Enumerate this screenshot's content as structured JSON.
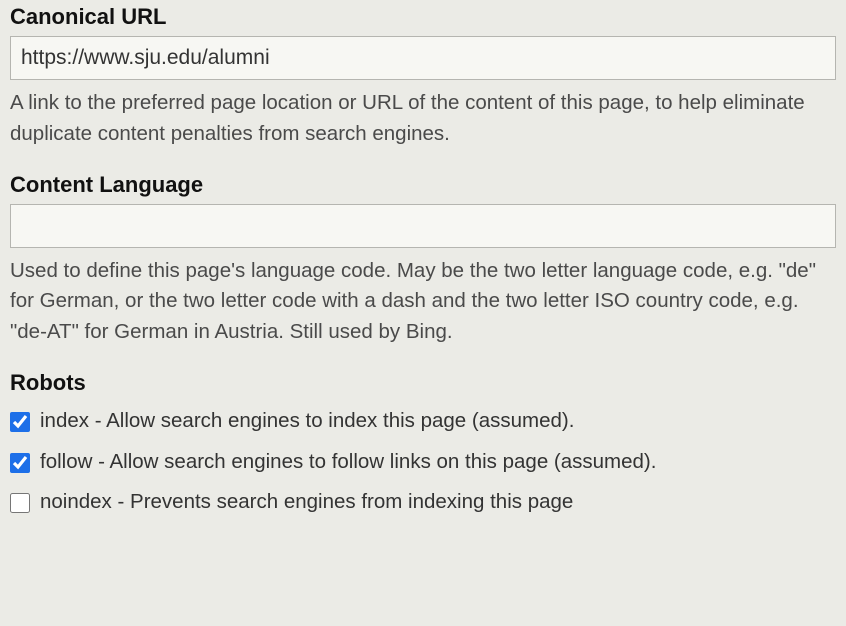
{
  "canonical": {
    "label": "Canonical URL",
    "value": "https://www.sju.edu/alumni",
    "help": "A link to the preferred page location or URL of the content of this page, to help eliminate duplicate content penalties from search engines."
  },
  "language": {
    "label": "Content Language",
    "value": "",
    "help": "Used to define this page's language code. May be the two letter language code, e.g. \"de\" for German, or the two letter code with a dash and the two letter ISO country code, e.g. \"de-AT\" for German in Austria. Still used by Bing."
  },
  "robots": {
    "label": "Robots",
    "options": [
      {
        "text": "index - Allow search engines to index this page (assumed).",
        "checked": true
      },
      {
        "text": "follow - Allow search engines to follow links on this page (assumed).",
        "checked": true
      },
      {
        "text": "noindex - Prevents search engines from indexing this page",
        "checked": false
      }
    ]
  }
}
